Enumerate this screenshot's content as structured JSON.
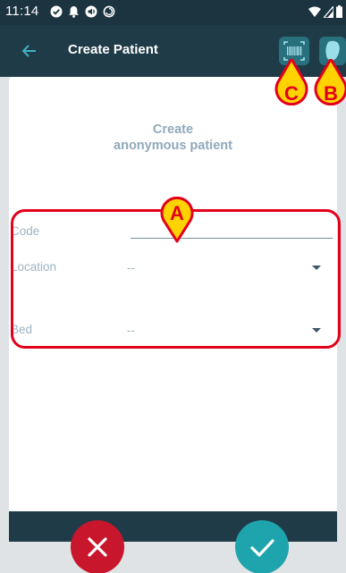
{
  "status_bar": {
    "time": "11:14",
    "left_icons": [
      "check-circle-icon",
      "notification-bell-icon",
      "volume-icon",
      "sync-icon"
    ],
    "right_icons": [
      "wifi-icon",
      "signal-icon",
      "battery-icon"
    ]
  },
  "toolbar": {
    "title": "Create Patient",
    "back_icon": "arrow-left-icon",
    "barcode_icon": "barcode-scan-icon",
    "nfc_icon": "nfc-tag-icon"
  },
  "form": {
    "title_line1": "Create",
    "title_line2": "anonymous patient",
    "code_label": "Code",
    "code_value": "",
    "location_label": "Location",
    "location_value": "--",
    "bed_label": "Bed",
    "bed_value": "--"
  },
  "actions": {
    "cancel_icon": "close-icon",
    "confirm_icon": "check-icon"
  },
  "callouts": {
    "a": "A",
    "b": "B",
    "c": "C"
  },
  "colors": {
    "toolbar": "#1f3b48",
    "status_bar": "#1c3340",
    "accent_teal": "#29707e",
    "cancel": "#c8162c",
    "confirm": "#1ea4ad",
    "label": "#9db3c2",
    "callout": "#e2001a",
    "callout_fill": "#ffd200"
  }
}
